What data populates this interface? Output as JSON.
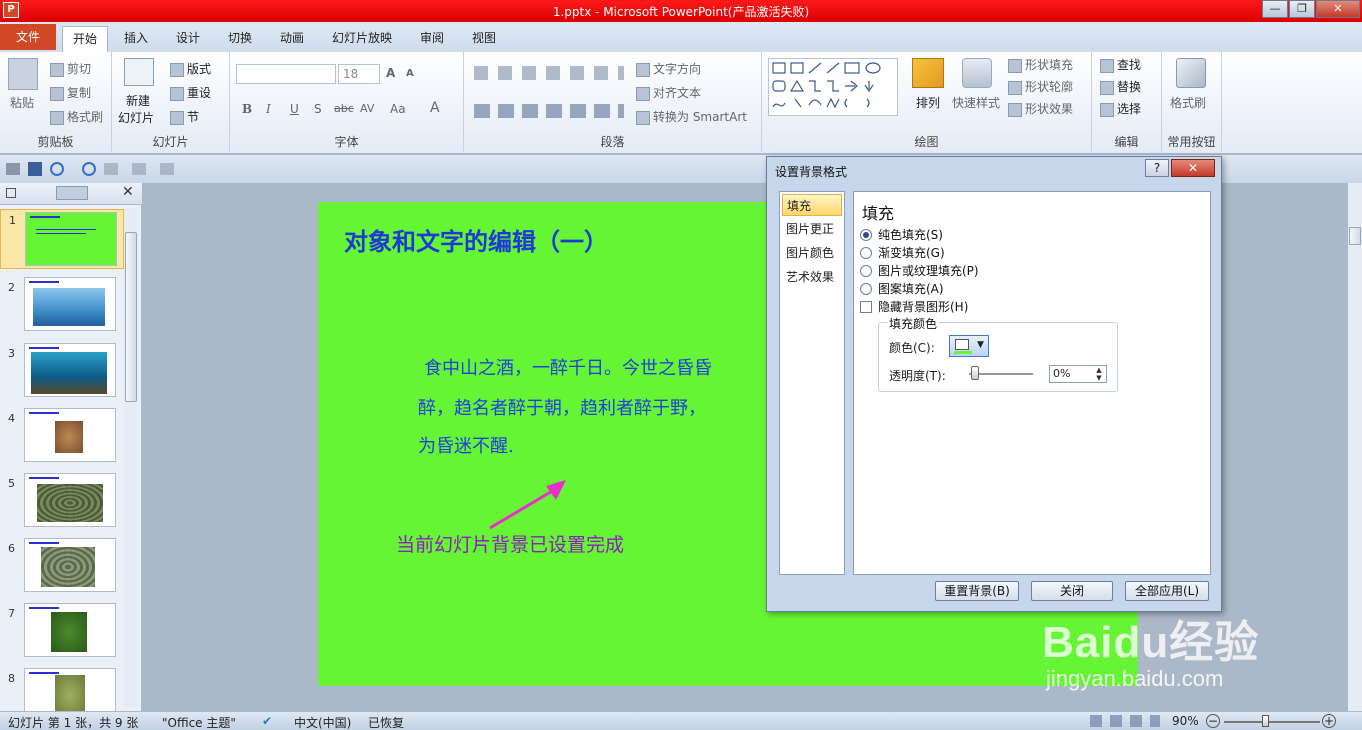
{
  "window": {
    "title": "1.pptx - Microsoft PowerPoint(产品激活失败)",
    "app_icon": "P",
    "controls": [
      "—",
      "❐",
      "✕"
    ]
  },
  "tabs": {
    "file": "文件",
    "items": [
      "开始",
      "插入",
      "设计",
      "切换",
      "动画",
      "幻灯片放映",
      "审阅",
      "视图"
    ],
    "active": "开始"
  },
  "ribbon": {
    "clipboard": {
      "label": "剪贴板",
      "paste": "粘贴",
      "cut": "剪切",
      "copy": "复制",
      "format_painter": "格式刷"
    },
    "slides": {
      "label": "幻灯片",
      "new_slide_1": "新建",
      "new_slide_2": "幻灯片",
      "layout": "版式",
      "reset": "重设",
      "section": "节"
    },
    "font": {
      "label": "字体",
      "size": "18",
      "bold": "B",
      "italic": "I",
      "underline": "U",
      "shadow": "S",
      "strike": "abc",
      "spacing": "AV",
      "case": "Aa",
      "color": "A",
      "grow": "A",
      "shrink": "A"
    },
    "paragraph": {
      "label": "段落",
      "text_direction": "文字方向",
      "align_text": "对齐文本",
      "smartart": "转换为 SmartArt"
    },
    "drawing": {
      "label": "绘图",
      "arrange": "排列",
      "quick_styles": "快速样式",
      "shape_fill": "形状填充",
      "shape_outline": "形状轮廓",
      "shape_effects": "形状效果"
    },
    "editing": {
      "label": "编辑",
      "find": "查找",
      "replace": "替换",
      "select": "选择"
    },
    "common": {
      "label": "常用按钮",
      "format_painter": "格式刷"
    }
  },
  "slide": {
    "title": "对象和文字的编辑（一）",
    "body_lines": [
      "食中山之酒，一醉千日。今世之昏昏",
      "醉，趋名者醉于朝，趋利者醉于野，",
      "为昏迷不醒."
    ],
    "caption": "当前幻灯片背景已设置完成",
    "background": "#66f534"
  },
  "thumbnails": [
    "1",
    "2",
    "3",
    "4",
    "5",
    "6",
    "7",
    "8"
  ],
  "dialog": {
    "title": "设置背景格式",
    "help": "?",
    "close": "✕",
    "nav": [
      "填充",
      "图片更正",
      "图片颜色",
      "艺术效果"
    ],
    "section_title": "填充",
    "options": {
      "solid": "纯色填充(S)",
      "gradient": "渐变填充(G)",
      "picture": "图片或纹理填充(P)",
      "pattern": "图案填充(A)",
      "hide": "隐藏背景图形(H)"
    },
    "fill_color": {
      "group_title": "填充颜色",
      "color_label": "颜色(C):",
      "transparency_label": "透明度(T):",
      "transparency_value": "0%"
    },
    "buttons": {
      "reset": "重置背景(B)",
      "close": "关闭",
      "apply_all": "全部应用(L)"
    }
  },
  "status": {
    "slide_info": "幻灯片 第 1 张，共 9 张",
    "theme": "\"Office 主题\"",
    "language": "中文(中国)",
    "recovered": "已恢复",
    "zoom": "90%"
  },
  "watermark": {
    "text": "Baidu经验",
    "url": "jingyan.baidu.com"
  }
}
